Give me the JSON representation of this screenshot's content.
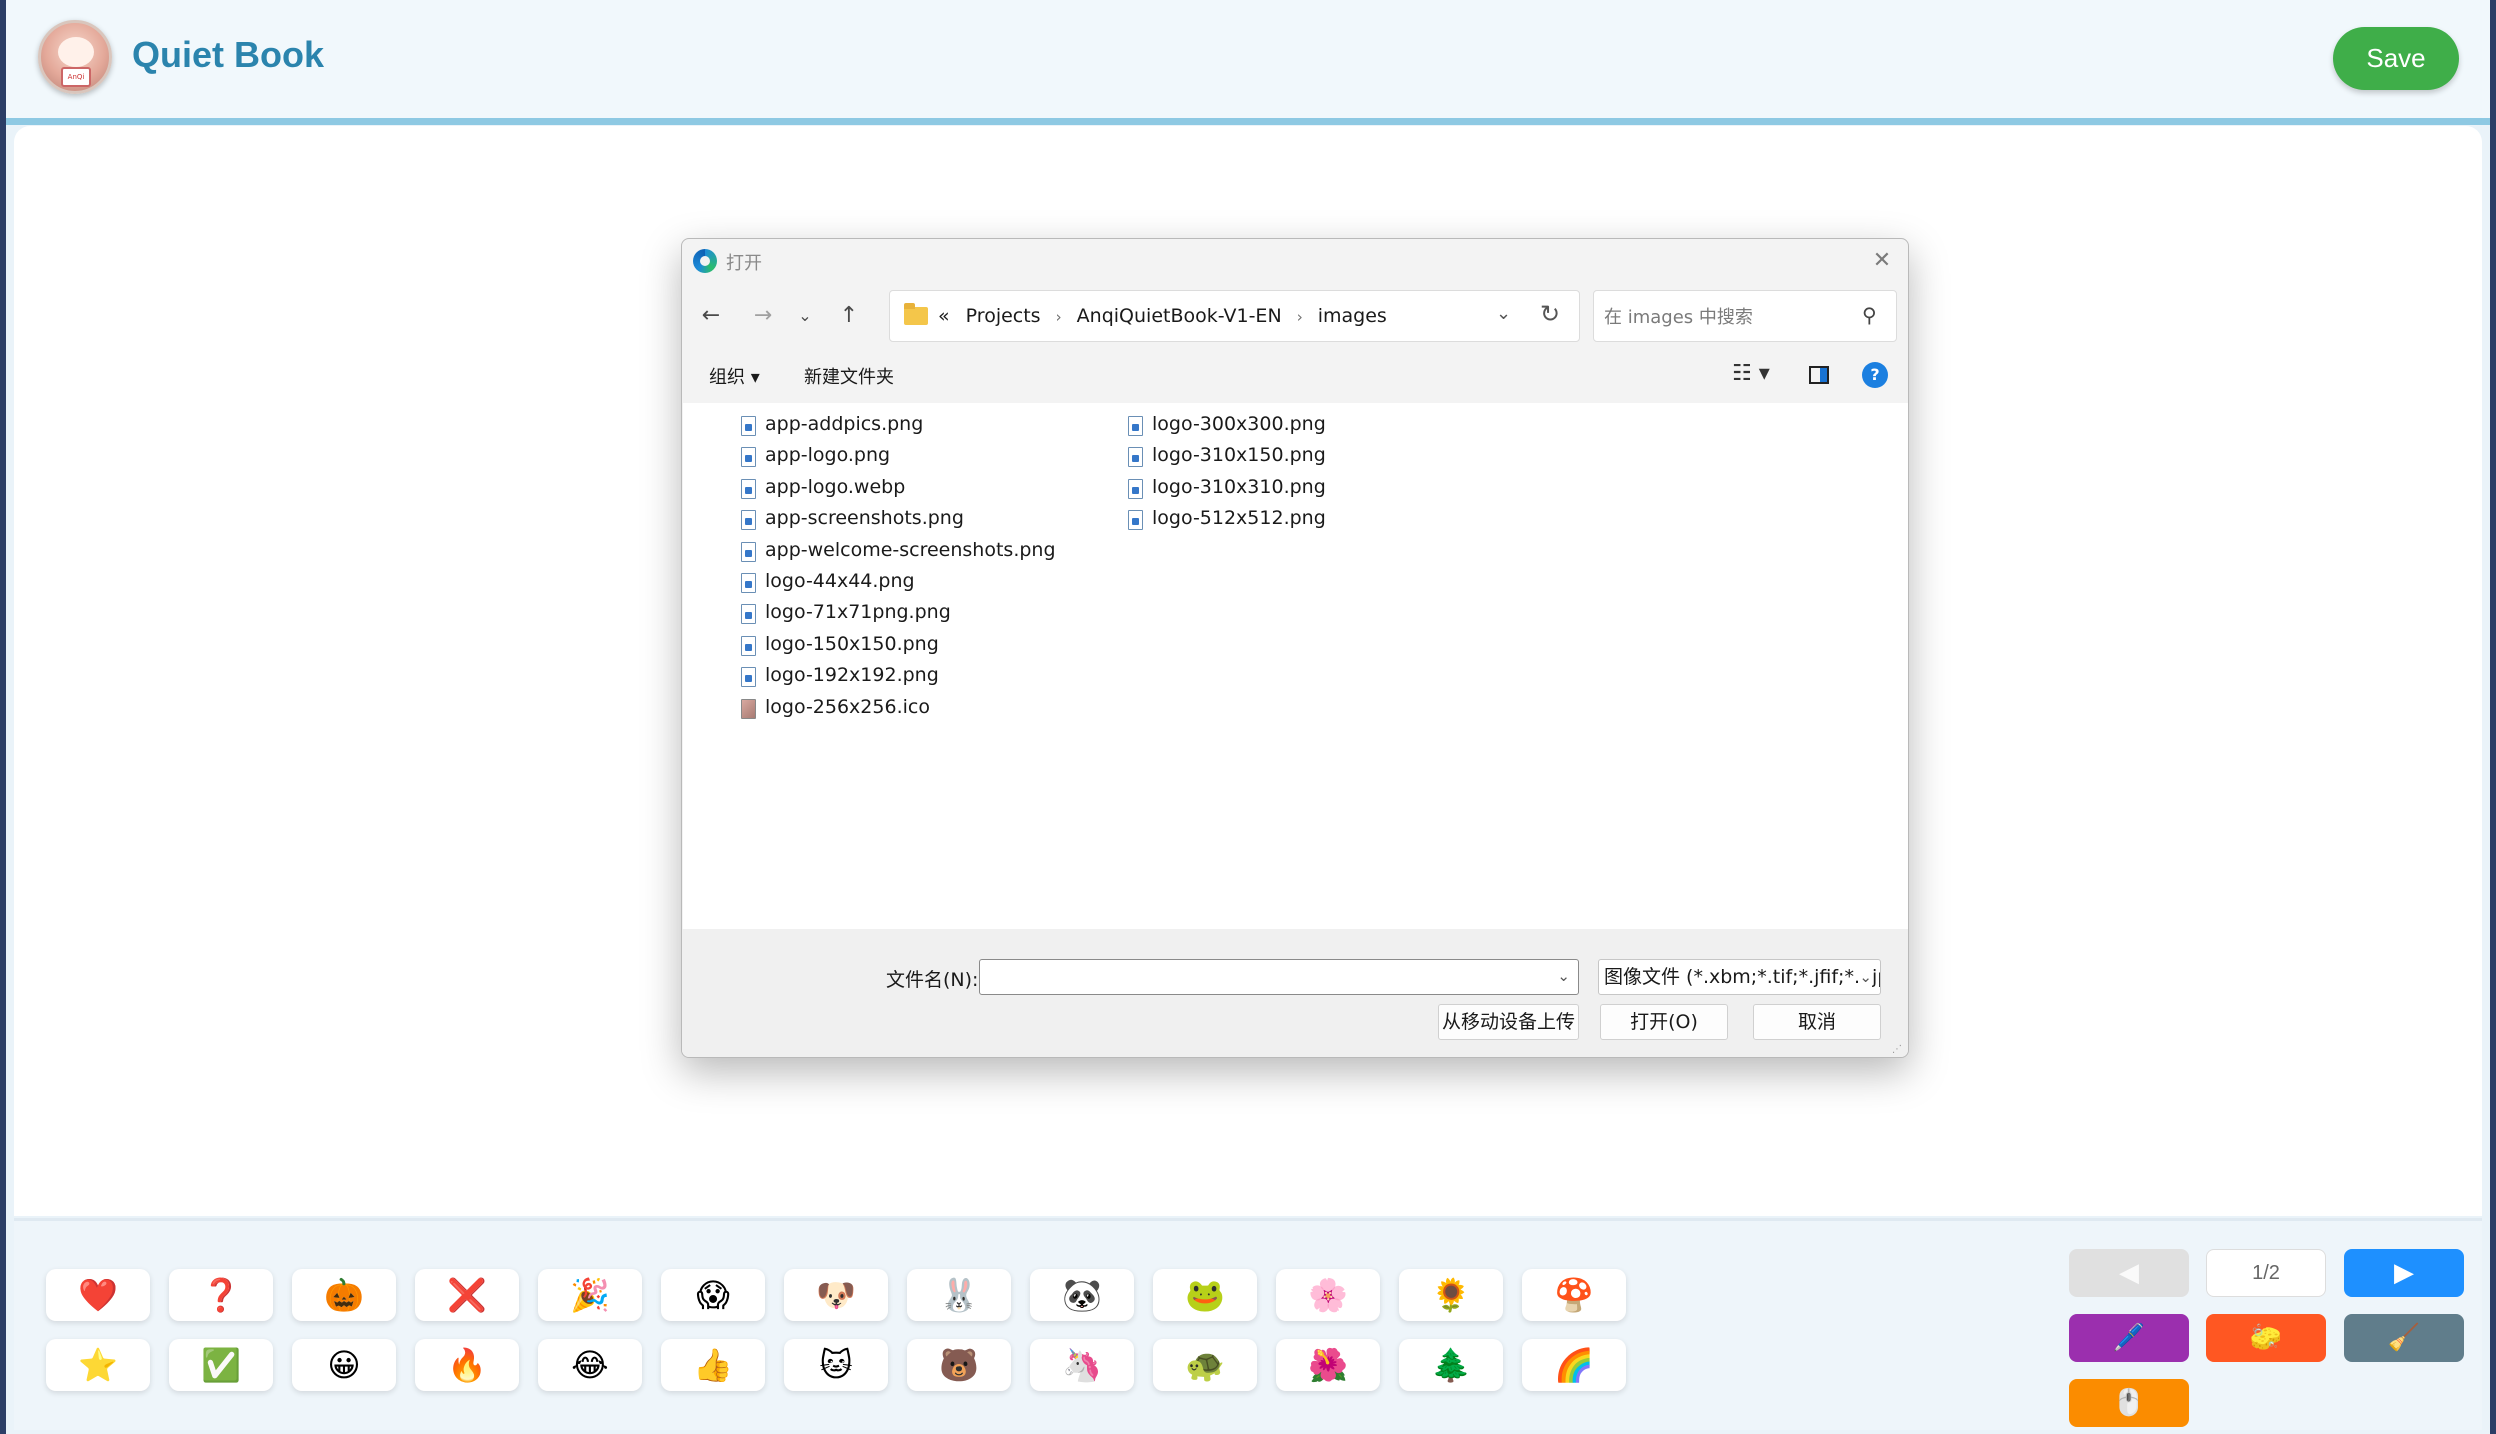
{
  "app": {
    "title": "Quiet Book",
    "save_label": "Save",
    "avatar_text": "AnQi"
  },
  "dialog": {
    "title": "打开",
    "close_glyph": "✕",
    "breadcrumb": [
      "Projects",
      "AnqiQuietBook-V1-EN",
      "images"
    ],
    "breadcrumb_prefix": "«",
    "search_placeholder": "在 images 中搜索",
    "toolbar": {
      "organize_label": "组织 ▾",
      "new_folder_label": "新建文件夹",
      "help_glyph": "?"
    },
    "files_col1": [
      "app-addpics.png",
      "app-logo.png",
      "app-logo.webp",
      "app-screenshots.png",
      "app-welcome-screenshots.png",
      "logo-44x44.png",
      "logo-71x71png.png",
      "logo-150x150.png",
      "logo-192x192.png",
      "logo-256x256.ico"
    ],
    "files_col2": [
      "logo-300x300.png",
      "logo-310x150.png",
      "logo-310x310.png",
      "logo-512x512.png"
    ],
    "filename_label": "文件名(N):",
    "filename_value": "",
    "filetype_value": "图像文件 (*.xbm;*.tif;*.jfif;*.pjp",
    "buttons": {
      "upload": "从移动设备上传",
      "open": "打开(O)",
      "cancel": "取消"
    }
  },
  "emoji_row1": [
    "❤️",
    "❓",
    "🎃",
    "❌",
    "🎉",
    "😱",
    "🐶",
    "🐰",
    "🐼",
    "🐸",
    "🌸",
    "🌻",
    "🍄"
  ],
  "emoji_row2": [
    "⭐",
    "✅",
    "😀",
    "🔥",
    "😂",
    "👍",
    "🐱",
    "🐻",
    "🦄",
    "🐢",
    "🌺",
    "🌲",
    "🌈"
  ],
  "controls": {
    "prev_glyph": "◀",
    "next_glyph": "▶",
    "page_indicator": "1/2",
    "pen_glyph": "🖊️",
    "eraser_glyph": "🧽",
    "broom_glyph": "🧹",
    "stamp_glyph": "🖱️"
  },
  "colors": {
    "accent": "#2b84ad",
    "save": "#3fae49",
    "next": "#1e90ff",
    "purple": "#9b2fae",
    "orange": "#ff5722",
    "slate": "#607d8b",
    "amber": "#fb8c00"
  }
}
